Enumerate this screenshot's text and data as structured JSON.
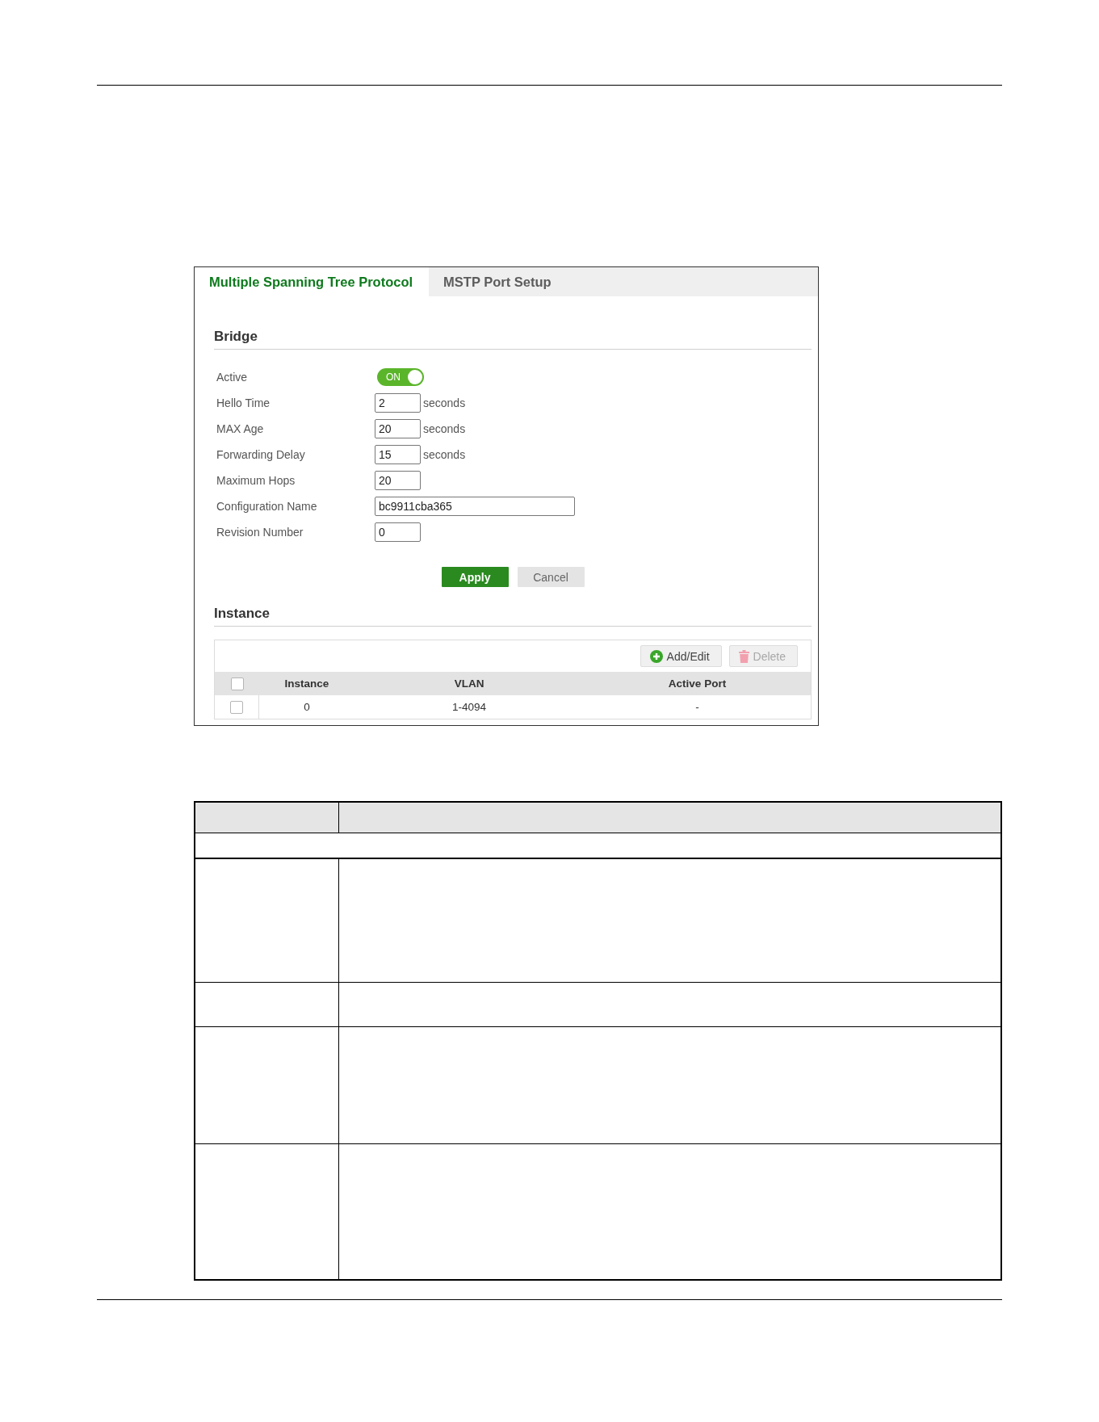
{
  "tabs": [
    {
      "label": "Multiple Spanning Tree Protocol",
      "selected": true
    },
    {
      "label": "MSTP Port Setup",
      "selected": false
    }
  ],
  "bridge": {
    "title": "Bridge",
    "active": {
      "label": "Active",
      "on": true,
      "state_text": "ON"
    },
    "fields": [
      {
        "label": "Hello Time",
        "value": "2",
        "unit": "seconds",
        "kind": "short"
      },
      {
        "label": "MAX Age",
        "value": "20",
        "unit": "seconds",
        "kind": "short"
      },
      {
        "label": "Forwarding Delay",
        "value": "15",
        "unit": "seconds",
        "kind": "short"
      },
      {
        "label": "Maximum Hops",
        "value": "20",
        "kind": "short"
      },
      {
        "label": "Configuration Name",
        "value": "bc9911cba365",
        "kind": "long"
      },
      {
        "label": "Revision Number",
        "value": "0",
        "kind": "short"
      }
    ]
  },
  "buttons": [
    {
      "label": "Apply",
      "kind": "primary"
    },
    {
      "label": "Cancel",
      "kind": "secondary"
    }
  ],
  "instance": {
    "title": "Instance",
    "actions": [
      {
        "label": "Add/Edit",
        "kind": "add",
        "disabled": false
      },
      {
        "label": "Delete",
        "kind": "delete",
        "disabled": true
      }
    ],
    "table": {
      "columns": [
        "Instance",
        "VLAN",
        "Active Port"
      ],
      "header_checked": false,
      "rows": [
        {
          "checked": false,
          "cells": [
            "0",
            "1-4094",
            "-"
          ]
        }
      ]
    }
  }
}
